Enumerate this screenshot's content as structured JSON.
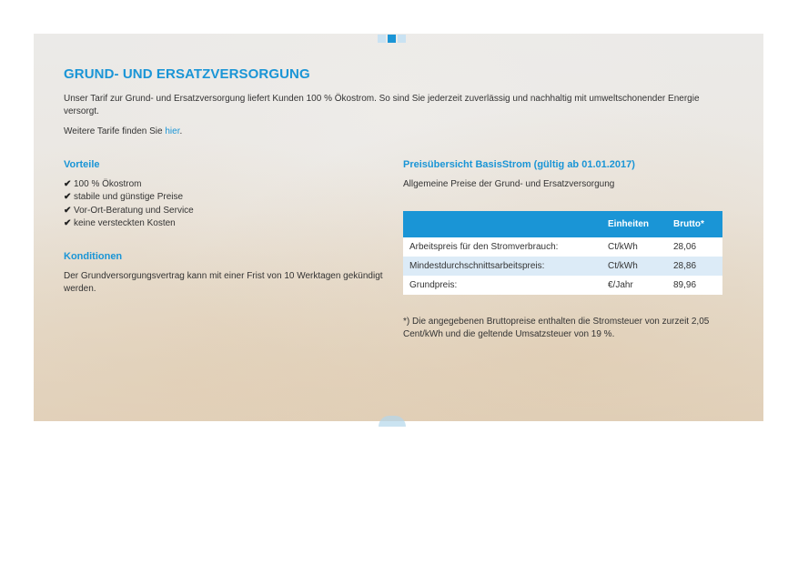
{
  "section": {
    "title": "GRUND- UND ERSATZVERSORGUNG",
    "intro": "Unser Tarif zur Grund- und Ersatzversorgung liefert Kunden 100 % Ökostrom. So sind Sie jederzeit zuverlässig und nachhaltig mit umweltschonender Energie versorgt.",
    "more_prefix": "Weitere Tarife finden Sie ",
    "more_link": "hier",
    "more_suffix": "."
  },
  "vorteile": {
    "title": "Vorteile",
    "items": [
      "100 % Ökostrom",
      "stabile und günstige Preise",
      "Vor-Ort-Beratung und Service",
      "keine versteckten Kosten"
    ]
  },
  "konditionen": {
    "title": "Konditionen",
    "text": "Der Grundversorgungsvertrag kann mit einer Frist von 10 Werktagen gekündigt werden."
  },
  "prices": {
    "title": "Preisübersicht BasisStrom (gültig ab 01.01.2017)",
    "subtitle": "Allgemeine Preise der Grund- und Ersatzversorgung",
    "headers": [
      "",
      "Einheiten",
      "Brutto*"
    ],
    "rows": [
      [
        "Arbeitspreis für den Stromverbrauch:",
        "Ct/kWh",
        "28,06"
      ],
      [
        "Mindestdurchschnittsarbeitspreis:",
        "Ct/kWh",
        "28,86"
      ],
      [
        "Grundpreis:",
        "€/Jahr",
        "89,96"
      ]
    ],
    "footnote": "*) Die angegebenen Bruttopreise enthalten die Stromsteuer von zurzeit 2,05 Cent/kWh und die geltende Umsatzsteuer von 19 %."
  },
  "icons": {
    "check": "check-icon"
  },
  "colors": {
    "accent": "#1a95d6",
    "row_alt": "#dcebf7"
  }
}
